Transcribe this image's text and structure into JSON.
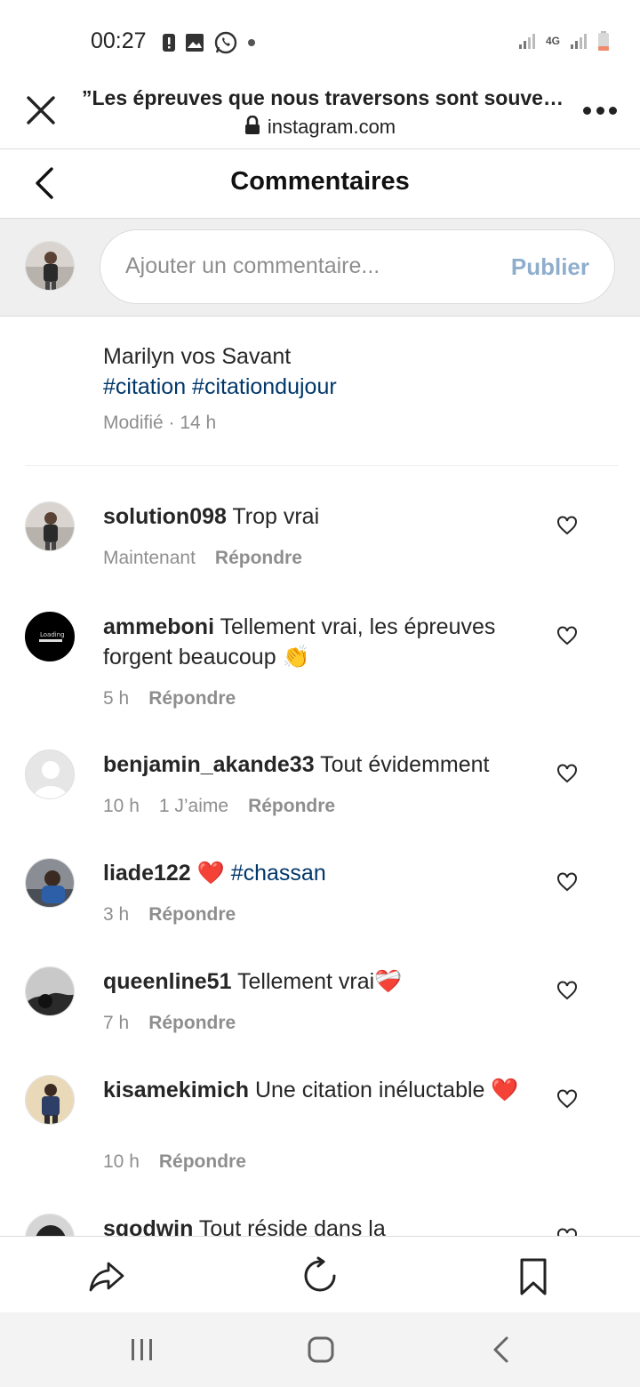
{
  "status_bar": {
    "time": "00:27",
    "network": "4G",
    "icons_left": [
      "alert-icon",
      "gallery-icon",
      "whatsapp-icon",
      "dot-icon"
    ],
    "icons_right": [
      "signal-icon",
      "network-4g-icon",
      "signal-icon",
      "battery-icon"
    ]
  },
  "browser": {
    "title": "”Les épreuves que nous traversons sont souve…",
    "domain": "instagram.com"
  },
  "header": {
    "title": "Commentaires"
  },
  "composer": {
    "placeholder": "Ajouter un commentaire...",
    "publish_label": "Publier"
  },
  "caption": {
    "author_line": "Marilyn vos Savant",
    "hashtags": "#citation #citationdujour",
    "meta": "Modifié · 14 h"
  },
  "comments": [
    {
      "user": "solution098",
      "text": " Trop vrai",
      "time": "Maintenant",
      "likes": "",
      "reply": "Répondre"
    },
    {
      "user": "ammeboni",
      "text": " Tellement vrai, les épreuves forgent beaucoup 👏",
      "time": "5 h",
      "likes": "",
      "reply": "Répondre"
    },
    {
      "user": "benjamin_akande33",
      "text": " Tout évidemment",
      "time": "10 h",
      "likes": "1 J’aime",
      "reply": "Répondre"
    },
    {
      "user": "liade122",
      "text": " ❤️ ",
      "hashtag": "#chassan",
      "time": "3 h",
      "likes": "",
      "reply": "Répondre"
    },
    {
      "user": "queenline51",
      "text": " Tellement vrai❤️‍🩹",
      "time": "7 h",
      "likes": "",
      "reply": "Répondre"
    },
    {
      "user": "kisamekimich",
      "text": " Une citation inéluctable ❤️",
      "time": "10 h",
      "likes": "",
      "reply": "Répondre"
    },
    {
      "user": "sgodwin",
      "text": "  Tout réside dans la",
      "time": "",
      "likes": "",
      "reply": ""
    }
  ],
  "avatar_loading_text": "Loading",
  "colors": {
    "hashtag": "#00376b",
    "publish": "#8faecd",
    "muted": "#8e8e8e",
    "composer_bg": "#efefef"
  }
}
